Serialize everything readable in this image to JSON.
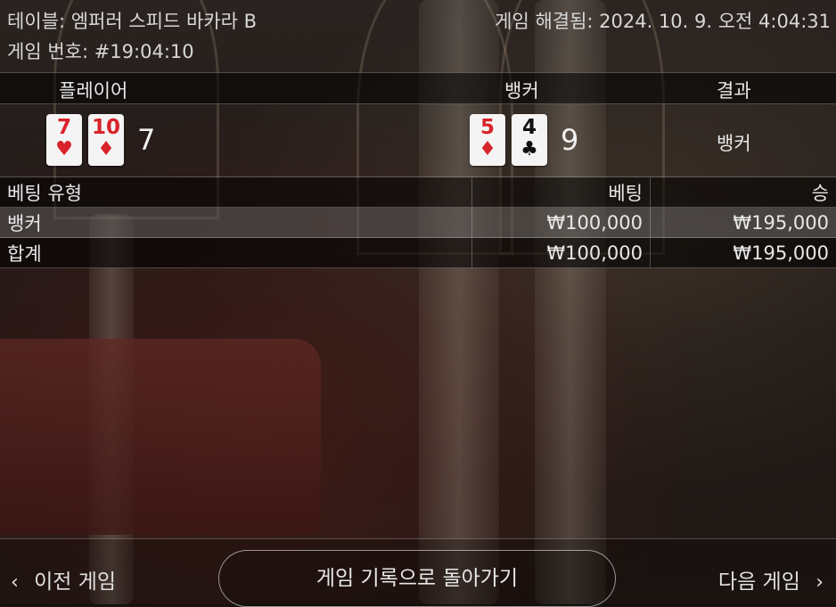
{
  "header": {
    "table_label": "테이블: 엠퍼러 스피드 바카라 B",
    "game_number": "게임 번호: #19:04:10",
    "resolved": "게임 해결됨: 2024. 10. 9. 오전 4:04:31"
  },
  "results": {
    "player_label": "플레이어",
    "banker_label": "뱅커",
    "result_label": "결과",
    "player_cards": [
      {
        "rank": "7",
        "suit": "♥",
        "suit_name": "heart",
        "color": "#d8232a"
      },
      {
        "rank": "10",
        "suit": "♦",
        "suit_name": "diamond",
        "color": "#d8232a"
      }
    ],
    "player_score": "7",
    "banker_cards": [
      {
        "rank": "5",
        "suit": "♦",
        "suit_name": "diamond",
        "color": "#d8232a"
      },
      {
        "rank": "4",
        "suit": "♣",
        "suit_name": "club",
        "color": "#111111"
      }
    ],
    "banker_score": "9",
    "result_value": "뱅커"
  },
  "bets": {
    "headers": [
      "베팅 유형",
      "베팅",
      "승"
    ],
    "rows": [
      {
        "type": "뱅커",
        "bet": "₩100,000",
        "win": "₩195,000"
      },
      {
        "type": "합계",
        "bet": "₩100,000",
        "win": "₩195,000"
      }
    ]
  },
  "footer": {
    "prev_label": "이전 게임",
    "back_label": "게임 기록으로 돌아가기",
    "next_label": "다음 게임",
    "prev_icon": "chevron-left-icon",
    "next_icon": "chevron-right-icon"
  }
}
